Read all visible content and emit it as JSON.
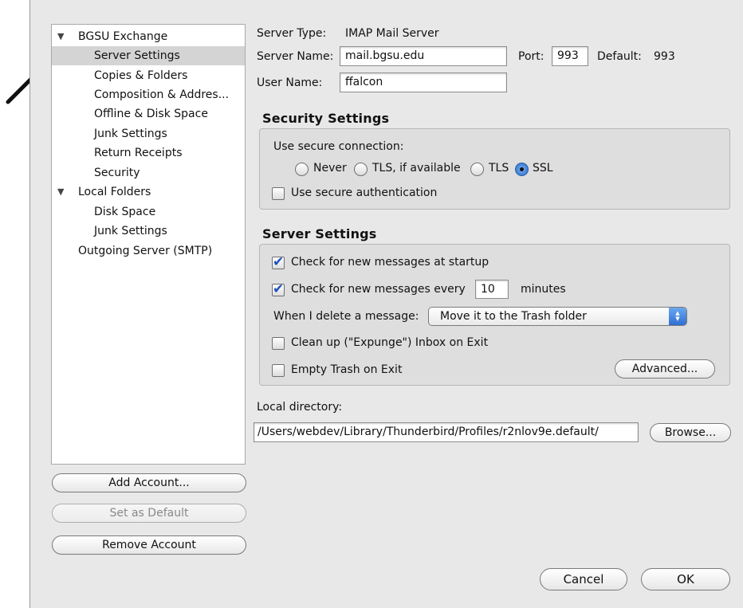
{
  "tree": {
    "items": [
      {
        "label": "BGSU Exchange",
        "expander": "▼",
        "level": 0
      },
      {
        "label": "Server Settings",
        "level": 1,
        "selected": true
      },
      {
        "label": "Copies & Folders",
        "level": 1
      },
      {
        "label": "Composition & Addres...",
        "level": 1
      },
      {
        "label": "Offline & Disk Space",
        "level": 1
      },
      {
        "label": "Junk Settings",
        "level": 1
      },
      {
        "label": "Return Receipts",
        "level": 1
      },
      {
        "label": "Security",
        "level": 1
      },
      {
        "label": "Local Folders",
        "expander": "▼",
        "level": 0
      },
      {
        "label": "Disk Space",
        "level": 1
      },
      {
        "label": "Junk Settings",
        "level": 1
      },
      {
        "label": "Outgoing Server (SMTP)",
        "level": 0
      }
    ]
  },
  "account_buttons": {
    "add": "Add Account...",
    "set_default": "Set as Default",
    "remove": "Remove Account"
  },
  "server": {
    "type_label": "Server Type:",
    "type_value": "IMAP Mail Server",
    "name_label": "Server Name:",
    "name_value": "mail.bgsu.edu",
    "port_label": "Port:",
    "port_value": "993",
    "default_label": "Default:",
    "default_value": "993",
    "user_label": "User Name:",
    "user_value": "ffalcon"
  },
  "security": {
    "title": "Security Settings",
    "use_secure_label": "Use secure connection:",
    "options": [
      "Never",
      "TLS, if available",
      "TLS",
      "SSL"
    ],
    "selected": "SSL",
    "secure_auth_label": "Use secure authentication",
    "secure_auth_checked": false
  },
  "server_settings": {
    "title": "Server Settings",
    "check_startup_label": "Check for new messages at startup",
    "check_startup_checked": true,
    "check_every_label": "Check for new messages every",
    "check_every_value": "10",
    "minutes_label": "minutes",
    "delete_label": "When I delete a message:",
    "delete_option": "Move it to the Trash folder",
    "cleanup_label": "Clean up (\"Expunge\") Inbox on Exit",
    "empty_trash_label": "Empty Trash on Exit",
    "advanced_button": "Advanced..."
  },
  "local_directory": {
    "label": "Local directory:",
    "path": "/Users/webdev/Library/Thunderbird/Profiles/r2nlov9e.default/",
    "browse_button": "Browse..."
  },
  "dialog_buttons": {
    "cancel": "Cancel",
    "ok": "OK"
  },
  "colors": {
    "window_bg": "#e8e8e8",
    "selection": "#d4d4d4",
    "accent": "#3d7fd8"
  }
}
